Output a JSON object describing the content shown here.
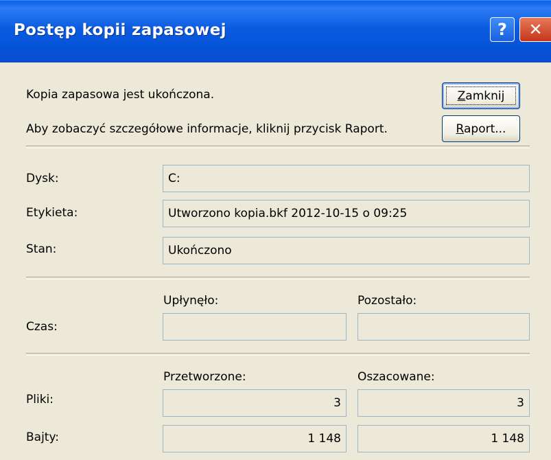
{
  "window": {
    "title": "Postęp kopii zapasowej"
  },
  "titlebar_buttons": {
    "help_glyph": "?",
    "close_glyph": "✕"
  },
  "status_message": "Kopia zapasowa jest ukończona.",
  "report_hint": "Aby zobaczyć szczegółowe informacje, kliknij przycisk Raport.",
  "buttons": {
    "close": {
      "accel": "Z",
      "rest": "amknij"
    },
    "report": {
      "accel": "R",
      "rest": "aport..."
    }
  },
  "details": {
    "drive_label": "Dysk:",
    "drive_value": "C:",
    "tag_label": "Etykieta:",
    "tag_value": "Utworzono kopia.bkf 2012-10-15 o 09:25",
    "state_label": "Stan:",
    "state_value": "Ukończono"
  },
  "time": {
    "label": "Czas:",
    "elapsed_header": "Upłynęło:",
    "elapsed_value": "",
    "remaining_header": "Pozostało:",
    "remaining_value": ""
  },
  "stats": {
    "processed_header": "Przetworzone:",
    "estimated_header": "Oszacowane:",
    "files_label": "Pliki:",
    "files_processed": "3",
    "files_estimated": "3",
    "bytes_label": "Bajty:",
    "bytes_processed": "1 148",
    "bytes_estimated": "1 148"
  }
}
